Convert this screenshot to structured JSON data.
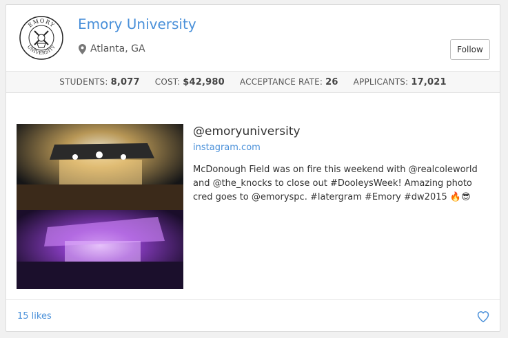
{
  "profile": {
    "name": "Emory University",
    "location": "Atlanta, GA",
    "logo_icon": "emory-seal-icon",
    "logo_text_top": "EMORY",
    "logo_text_bottom": "UNIVERSITY",
    "follow_label": "Follow"
  },
  "stats": [
    {
      "label": "STUDENTS:",
      "value": "8,077"
    },
    {
      "label": "COST:",
      "value": "$42,980"
    },
    {
      "label": "ACCEPTANCE RATE:",
      "value": "26"
    },
    {
      "label": "APPLICANTS:",
      "value": "17,021"
    }
  ],
  "post": {
    "handle": "@emoryuniversity",
    "source": "instagram.com",
    "caption": "McDonough Field was on fire this weekend with @realcoleworld and @the_knocks to close out #DooleysWeek! Amazing photo cred goes to @emoryspc. #latergram #Emory #dw2015 🔥😎"
  },
  "footer": {
    "likes": "15 likes",
    "like_icon": "heart-icon"
  },
  "colors": {
    "link": "#4a90d9",
    "stats_bg": "#f7f7f7",
    "border": "#dcdcdc"
  }
}
